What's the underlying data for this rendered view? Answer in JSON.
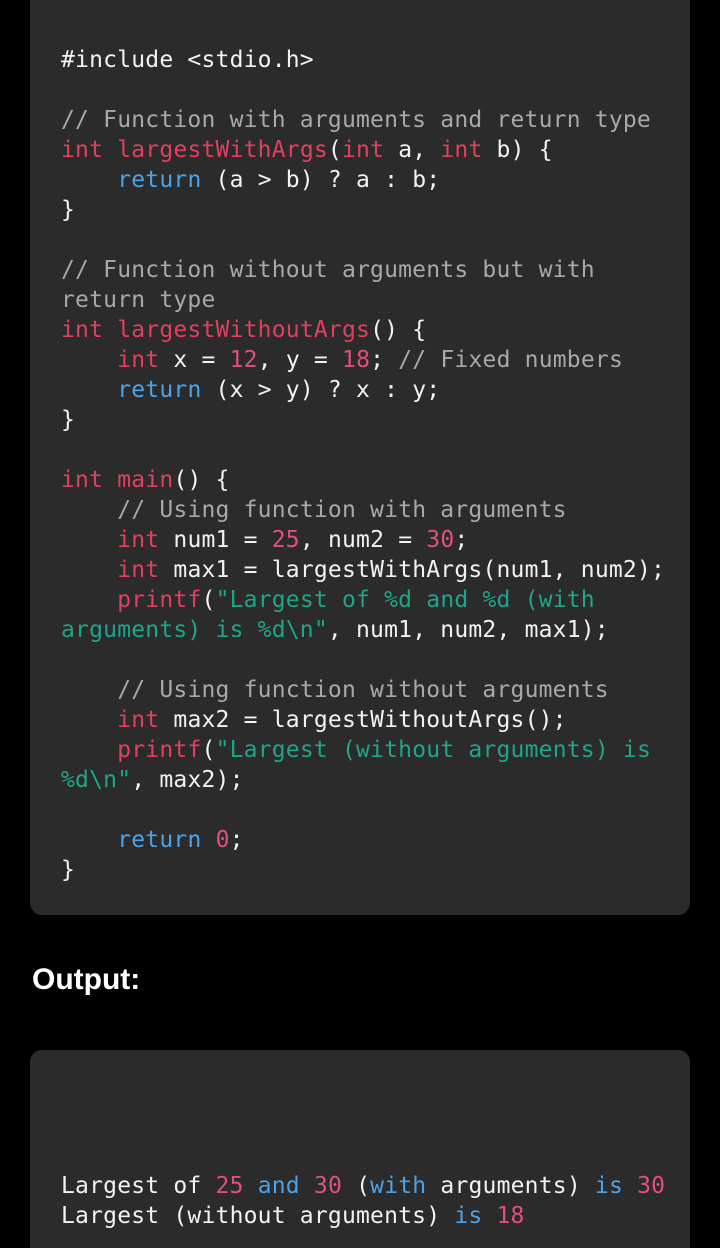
{
  "code": {
    "lines": [
      [
        {
          "t": "#include <stdio.h>",
          "c": "df"
        }
      ],
      [],
      [
        {
          "t": "// Function with arguments and return type",
          "c": "cm"
        }
      ],
      [
        {
          "t": "int ",
          "c": "kw"
        },
        {
          "t": "largestWithArgs",
          "c": "kw"
        },
        {
          "t": "(",
          "c": "df"
        },
        {
          "t": "int",
          "c": "kw"
        },
        {
          "t": " a, ",
          "c": "df"
        },
        {
          "t": "int",
          "c": "kw"
        },
        {
          "t": " b) {",
          "c": "df"
        }
      ],
      [
        {
          "t": "    ",
          "c": "df"
        },
        {
          "t": "return",
          "c": "bl"
        },
        {
          "t": " (a > b) ? a : b;",
          "c": "df"
        }
      ],
      [
        {
          "t": "}",
          "c": "df"
        }
      ],
      [],
      [
        {
          "t": "// Function without arguments but with",
          "c": "cm"
        }
      ],
      [
        {
          "t": "return type",
          "c": "cm"
        }
      ],
      [
        {
          "t": "int ",
          "c": "kw"
        },
        {
          "t": "largestWithoutArgs",
          "c": "kw"
        },
        {
          "t": "() {",
          "c": "df"
        }
      ],
      [
        {
          "t": "    ",
          "c": "df"
        },
        {
          "t": "int",
          "c": "kw"
        },
        {
          "t": " x = ",
          "c": "df"
        },
        {
          "t": "12",
          "c": "nm"
        },
        {
          "t": ", y = ",
          "c": "df"
        },
        {
          "t": "18",
          "c": "nm"
        },
        {
          "t": "; ",
          "c": "df"
        },
        {
          "t": "// Fixed numbers",
          "c": "cm"
        }
      ],
      [
        {
          "t": "    ",
          "c": "df"
        },
        {
          "t": "return",
          "c": "bl"
        },
        {
          "t": " (x > y) ? x : y;",
          "c": "df"
        }
      ],
      [
        {
          "t": "}",
          "c": "df"
        }
      ],
      [],
      [
        {
          "t": "int ",
          "c": "kw"
        },
        {
          "t": "main",
          "c": "kw"
        },
        {
          "t": "() {",
          "c": "df"
        }
      ],
      [
        {
          "t": "    ",
          "c": "df"
        },
        {
          "t": "// Using function with arguments",
          "c": "cm"
        }
      ],
      [
        {
          "t": "    ",
          "c": "df"
        },
        {
          "t": "int",
          "c": "kw"
        },
        {
          "t": " num1 = ",
          "c": "df"
        },
        {
          "t": "25",
          "c": "nm"
        },
        {
          "t": ", num2 = ",
          "c": "df"
        },
        {
          "t": "30",
          "c": "nm"
        },
        {
          "t": ";",
          "c": "df"
        }
      ],
      [
        {
          "t": "    ",
          "c": "df"
        },
        {
          "t": "int",
          "c": "kw"
        },
        {
          "t": " max1 = largestWithArgs(num1, num2);",
          "c": "df"
        }
      ],
      [
        {
          "t": "    ",
          "c": "df"
        },
        {
          "t": "printf",
          "c": "fn"
        },
        {
          "t": "(",
          "c": "df"
        },
        {
          "t": "\"Largest of %d and %d (with",
          "c": "st"
        }
      ],
      [
        {
          "t": "arguments) is %d\\n\"",
          "c": "st"
        },
        {
          "t": ", num1, num2, max1);",
          "c": "df"
        }
      ],
      [],
      [
        {
          "t": "    ",
          "c": "df"
        },
        {
          "t": "// Using function without arguments",
          "c": "cm"
        }
      ],
      [
        {
          "t": "    ",
          "c": "df"
        },
        {
          "t": "int",
          "c": "kw"
        },
        {
          "t": " max2 = largestWithoutArgs();",
          "c": "df"
        }
      ],
      [
        {
          "t": "    ",
          "c": "df"
        },
        {
          "t": "printf",
          "c": "fn"
        },
        {
          "t": "(",
          "c": "df"
        },
        {
          "t": "\"Largest (without arguments) is",
          "c": "st"
        }
      ],
      [
        {
          "t": "%d\\n\"",
          "c": "st"
        },
        {
          "t": ", max2);",
          "c": "df"
        }
      ],
      [],
      [
        {
          "t": "    ",
          "c": "df"
        },
        {
          "t": "return",
          "c": "bl"
        },
        {
          "t": " ",
          "c": "df"
        },
        {
          "t": "0",
          "c": "nm"
        },
        {
          "t": ";",
          "c": "df"
        }
      ],
      [
        {
          "t": "}",
          "c": "df"
        }
      ]
    ]
  },
  "output_section": {
    "title": "Output:"
  },
  "output": {
    "lines": [
      [
        {
          "t": "Largest of ",
          "c": "df"
        },
        {
          "t": "25",
          "c": "nm"
        },
        {
          "t": " ",
          "c": "df"
        },
        {
          "t": "and",
          "c": "bl"
        },
        {
          "t": " ",
          "c": "df"
        },
        {
          "t": "30",
          "c": "nm"
        },
        {
          "t": " (",
          "c": "df"
        },
        {
          "t": "with",
          "c": "bl"
        },
        {
          "t": " arguments) ",
          "c": "df"
        },
        {
          "t": "is",
          "c": "bl"
        },
        {
          "t": " ",
          "c": "df"
        },
        {
          "t": "30",
          "c": "nm"
        }
      ],
      [
        {
          "t": "Largest (without arguments) ",
          "c": "df"
        },
        {
          "t": "is",
          "c": "bl"
        },
        {
          "t": " ",
          "c": "df"
        },
        {
          "t": "18",
          "c": "nm"
        }
      ]
    ]
  },
  "colors": {
    "background": "#000000",
    "card": "#2b2b2b",
    "keyword": "#e0405e",
    "return_keyword": "#4aa3e8",
    "comment": "#a8a8a8",
    "string": "#1fa58a",
    "number": "#e0507a",
    "text": "#f2f2f2"
  }
}
